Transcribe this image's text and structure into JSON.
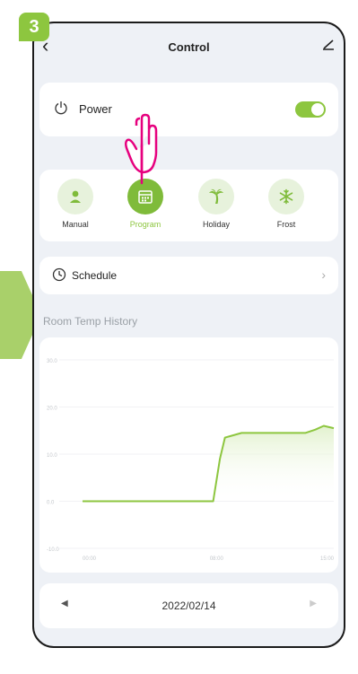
{
  "step": {
    "number": "3"
  },
  "header": {
    "title": "Control"
  },
  "power": {
    "label": "Power",
    "enabled": true
  },
  "modes": [
    {
      "label": "Manual",
      "icon": "person-icon",
      "active": false
    },
    {
      "label": "Program",
      "icon": "calendar-icon",
      "active": true
    },
    {
      "label": "Holiday",
      "icon": "palm-tree-icon",
      "active": false
    },
    {
      "label": "Frost",
      "icon": "snowflake-icon",
      "active": false
    }
  ],
  "schedule": {
    "label": "Schedule"
  },
  "history": {
    "title": "Room Temp History"
  },
  "chart_data": {
    "type": "area",
    "y_ticks": [
      "30.0",
      "20.0",
      "10.0",
      "0.0",
      "-10.0"
    ],
    "x_ticks": [
      "00:00",
      "08:00",
      "15:00"
    ],
    "ylim": [
      -10,
      30
    ],
    "x": [
      0.0,
      6.0,
      7.8,
      8.2,
      8.5,
      9.5,
      13.3,
      13.9,
      14.4,
      15.0
    ],
    "y": [
      0.0,
      0.0,
      0.0,
      9.0,
      13.5,
      14.5,
      14.5,
      15.2,
      16.0,
      15.5
    ]
  },
  "date_nav": {
    "date": "2022/02/14"
  },
  "colors": {
    "accent": "#8dc63f",
    "active_mode": "#7fbb3a",
    "mode_bg": "#e7f2dc",
    "hand": "#e6007e"
  }
}
